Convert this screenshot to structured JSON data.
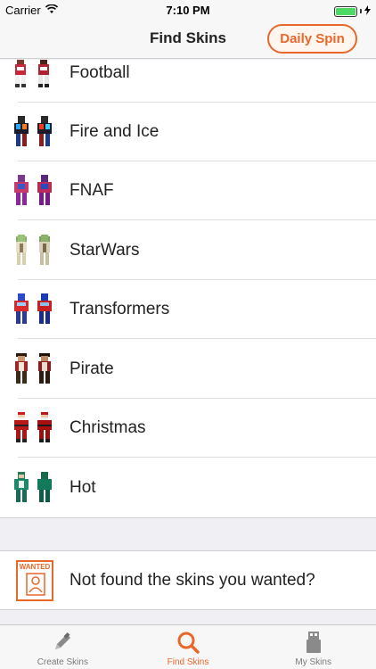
{
  "status_bar": {
    "carrier": "Carrier",
    "time": "7:10 PM",
    "battery_level": 1.0
  },
  "nav": {
    "title": "Find Skins",
    "daily_spin_label": "Daily Spin"
  },
  "skins": [
    {
      "label": "Football"
    },
    {
      "label": "Fire and Ice"
    },
    {
      "label": "FNAF"
    },
    {
      "label": "StarWars"
    },
    {
      "label": "Transformers"
    },
    {
      "label": "Pirate"
    },
    {
      "label": "Christmas"
    },
    {
      "label": "Hot"
    }
  ],
  "suggest": {
    "badge_text": "WANTED",
    "label": "Not found the skins you wanted?"
  },
  "tabs": [
    {
      "label": "Create Skins",
      "icon": "pencil-icon"
    },
    {
      "label": "Find Skins",
      "icon": "search-icon",
      "active": true
    },
    {
      "label": "My Skins",
      "icon": "usb-drive-icon"
    }
  ],
  "colors": {
    "accent": "#e8672a",
    "battery": "#4cd964"
  }
}
